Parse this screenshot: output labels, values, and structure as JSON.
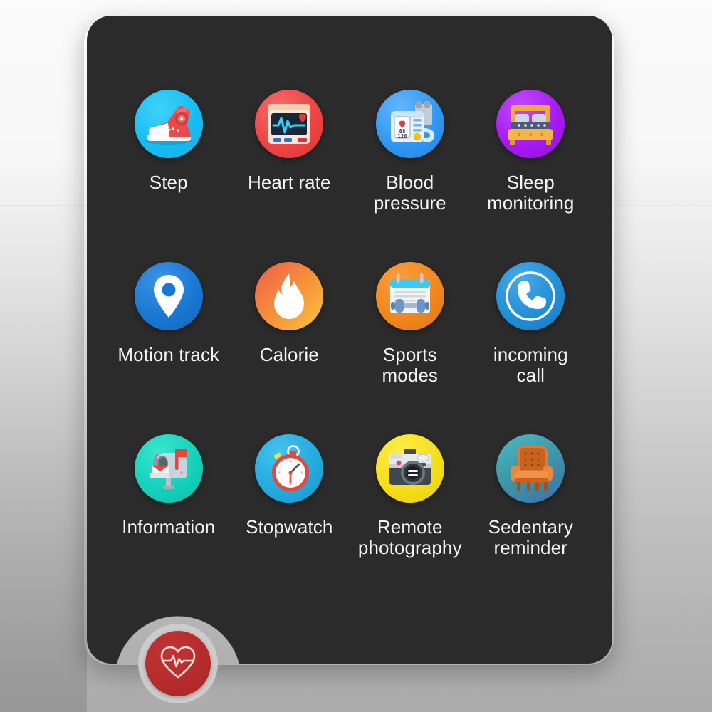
{
  "device": {
    "panel_color": "#2b2b2b",
    "background_top_color": "#fbfbfb",
    "background_bottom_color": "#979797"
  },
  "grid": {
    "columns": 4,
    "rows": 3,
    "tiles": [
      {
        "id": "step",
        "label": "Step",
        "icon": "sneaker-icon",
        "badge_color": "#1fc0f1"
      },
      {
        "id": "heart-rate",
        "label": "Heart rate",
        "icon": "ecg-monitor-icon",
        "badge_color": "#ee4444"
      },
      {
        "id": "blood-pressure",
        "label": "Blood\npressure",
        "icon": "bp-monitor-icon",
        "badge_color": "#2f97f0"
      },
      {
        "id": "sleep-monitoring",
        "label": "Sleep\nmonitoring",
        "icon": "bed-icon",
        "badge_color": "#a519f0"
      },
      {
        "id": "motion-track",
        "label": "Motion track",
        "icon": "map-pin-icon",
        "badge_color": "#1877d2"
      },
      {
        "id": "calorie",
        "label": "Calorie",
        "icon": "flame-icon",
        "badge_color": "#f4a63b"
      },
      {
        "id": "sports-modes",
        "label": "Sports\nmodes",
        "icon": "clipboard-dumbbell-icon",
        "badge_color": "#f0861e"
      },
      {
        "id": "incoming-call",
        "label": "incoming\ncall",
        "icon": "phone-handset-icon",
        "badge_color": "#1f8ed6"
      },
      {
        "id": "information",
        "label": "Information",
        "icon": "mailbox-icon",
        "badge_color": "#14d0ba"
      },
      {
        "id": "stopwatch",
        "label": "Stopwatch",
        "icon": "stopwatch-icon",
        "badge_color": "#22a9dd"
      },
      {
        "id": "remote-photography",
        "label": "Remote\nphotography",
        "icon": "camera-icon",
        "badge_color": "#f5dd18"
      },
      {
        "id": "sedentary-reminder",
        "label": "Sedentary\nreminder",
        "icon": "armchair-icon",
        "badge_color": "#3e9aa8"
      }
    ]
  },
  "bottom_button": {
    "id": "heart-rate-measure",
    "icon": "heart-pulse-icon",
    "color": "#b42b2b"
  },
  "icon_details": {
    "blood_pressure_display_top": "88",
    "blood_pressure_display_bottom": "120"
  }
}
